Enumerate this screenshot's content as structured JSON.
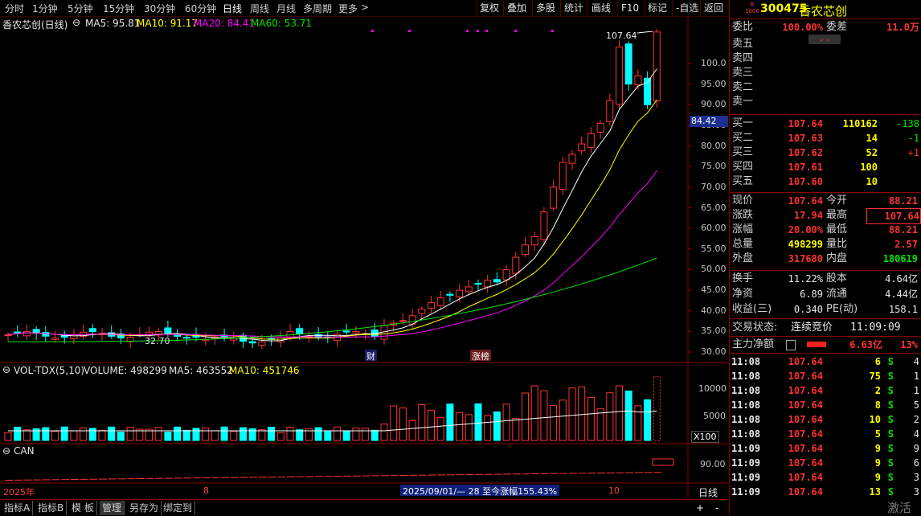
{
  "toolbar": {
    "periods": [
      "分时",
      "1分钟",
      "5分钟",
      "15分钟",
      "30分钟",
      "60分钟",
      "日线",
      "周线",
      "月线",
      "多周期",
      "更多"
    ],
    "active_period": "日线",
    "more_arrow": ">",
    "tools": [
      "复权",
      "叠加",
      "多股",
      "统计",
      "画线",
      "F10",
      "标记",
      "-自选",
      "返回"
    ]
  },
  "chart_header": {
    "title": "香农芯创(日线)",
    "ma5": "MA5: 95.81",
    "ma10": "MA10: 91.17",
    "ma20": "MA20: 84.41",
    "ma60": "MA60: 53.71"
  },
  "price_axis": {
    "ticks": [
      "100.0",
      "95.00",
      "90.00",
      "85.00",
      "80.00",
      "75.00",
      "70.00",
      "65.00",
      "60.00",
      "55.00",
      "50.00",
      "45.00",
      "40.00",
      "35.00",
      "30.00"
    ],
    "current_marker": "84.42",
    "high_label": "107.64",
    "low_label": "32.70"
  },
  "event_tags": {
    "cai": "财",
    "zhangbang": "涨榜"
  },
  "volume_header": {
    "name": "VOL-TDX(5,10)",
    "volume": "VOLUME: 498299",
    "ma5": "MA5: 463552",
    "ma10": "MA10: 451746"
  },
  "volume_axis": {
    "ticks": [
      "10000",
      "5000"
    ],
    "unit": "X100"
  },
  "can_header": {
    "name": "CAN",
    "tick": "90.00"
  },
  "date_axis": {
    "year": "2025年",
    "month8": "8",
    "month10": "10",
    "range_text": "2025/09/01/— 28 至今涨幅155.43%",
    "period": "日线"
  },
  "bottom_tabs": [
    "指标A",
    "指标B",
    "模 板",
    "管理",
    "另存为",
    "绑定到"
  ],
  "bottom_icons": {
    "plus": "+",
    "minus": "-"
  },
  "stock": {
    "code": "300475",
    "name": "香农芯创",
    "badge_top": "R",
    "badge_bottom": "1000"
  },
  "order": {
    "weibi_label": "委比",
    "weibi": "100.00%",
    "weicha_label": "委差",
    "weicha": "11.0万",
    "sell_labels": [
      "卖五",
      "卖四",
      "卖三",
      "卖二",
      "卖一"
    ],
    "buy": [
      {
        "label": "买一",
        "price": "107.64",
        "vol": "110162",
        "chg": "-138"
      },
      {
        "label": "买二",
        "price": "107.63",
        "vol": "14",
        "chg": "-1"
      },
      {
        "label": "买三",
        "price": "107.62",
        "vol": "52",
        "chg": "+1"
      },
      {
        "label": "买四",
        "price": "107.61",
        "vol": "100",
        "chg": ""
      },
      {
        "label": "买五",
        "price": "107.60",
        "vol": "10",
        "chg": ""
      }
    ]
  },
  "quote": [
    {
      "l1": "现价",
      "v1": "107.64",
      "l2": "今开",
      "v2": "88.21"
    },
    {
      "l1": "涨跌",
      "v1": "17.94",
      "l2": "最高",
      "v2": "107.64"
    },
    {
      "l1": "涨幅",
      "v1": "20.00%",
      "l2": "最低",
      "v2": "88.21"
    },
    {
      "l1": "总量",
      "v1": "498299",
      "l2": "量比",
      "v2": "2.57"
    },
    {
      "l1": "外盘",
      "v1": "317680",
      "l2": "内盘",
      "v2": "180619"
    }
  ],
  "fundamentals": [
    {
      "l1": "换手",
      "v1": "11.22%",
      "l2": "股本",
      "v2": "4.64亿"
    },
    {
      "l1": "净资",
      "v1": "6.89",
      "l2": "流通",
      "v2": "4.44亿"
    },
    {
      "l1": "收益(三)",
      "v1": "0.340",
      "l2": "PE(动)",
      "v2": "158.1"
    }
  ],
  "status": {
    "label": "交易状态:",
    "value": "连续竞价",
    "time": "11:09:09"
  },
  "mainflow": {
    "label": "主力净额",
    "value": "6.63亿",
    "pct": "13%"
  },
  "ticks": [
    {
      "t": "11:08",
      "p": "107.64",
      "v": "6",
      "s": "S",
      "n": "4"
    },
    {
      "t": "11:08",
      "p": "107.64",
      "v": "75",
      "s": "S",
      "n": "1"
    },
    {
      "t": "11:08",
      "p": "107.64",
      "v": "2",
      "s": "S",
      "n": "1"
    },
    {
      "t": "11:08",
      "p": "107.64",
      "v": "8",
      "s": "S",
      "n": "5"
    },
    {
      "t": "11:08",
      "p": "107.64",
      "v": "10",
      "s": "S",
      "n": "2"
    },
    {
      "t": "11:08",
      "p": "107.64",
      "v": "5",
      "s": "S",
      "n": "4"
    },
    {
      "t": "11:09",
      "p": "107.64",
      "v": "9",
      "s": "S",
      "n": "9"
    },
    {
      "t": "11:09",
      "p": "107.64",
      "v": "9",
      "s": "S",
      "n": "6"
    },
    {
      "t": "11:09",
      "p": "107.64",
      "v": "9",
      "s": "S",
      "n": "3"
    },
    {
      "t": "11:09",
      "p": "107.64",
      "v": "13",
      "s": "S",
      "n": "3"
    }
  ],
  "footer": {
    "activate": "激活"
  },
  "colors": {
    "up": "#ff3232",
    "down": "#00ffff",
    "ma5": "#ffffff",
    "ma10": "#ffff00",
    "ma20": "#ff00ff",
    "ma60": "#00e600",
    "frame": "#8a0000"
  },
  "chart_data": {
    "type": "candlestick",
    "title": "香农芯创(日线)",
    "ylim": [
      30,
      108
    ],
    "last_close": 107.64,
    "high": 107.64,
    "low": 32.7,
    "ma": {
      "MA5": 95.81,
      "MA10": 91.17,
      "MA20": 84.41,
      "MA60": 53.71
    },
    "volume": 498299,
    "volume_ma5": 463552,
    "volume_ma10": 451746
  }
}
